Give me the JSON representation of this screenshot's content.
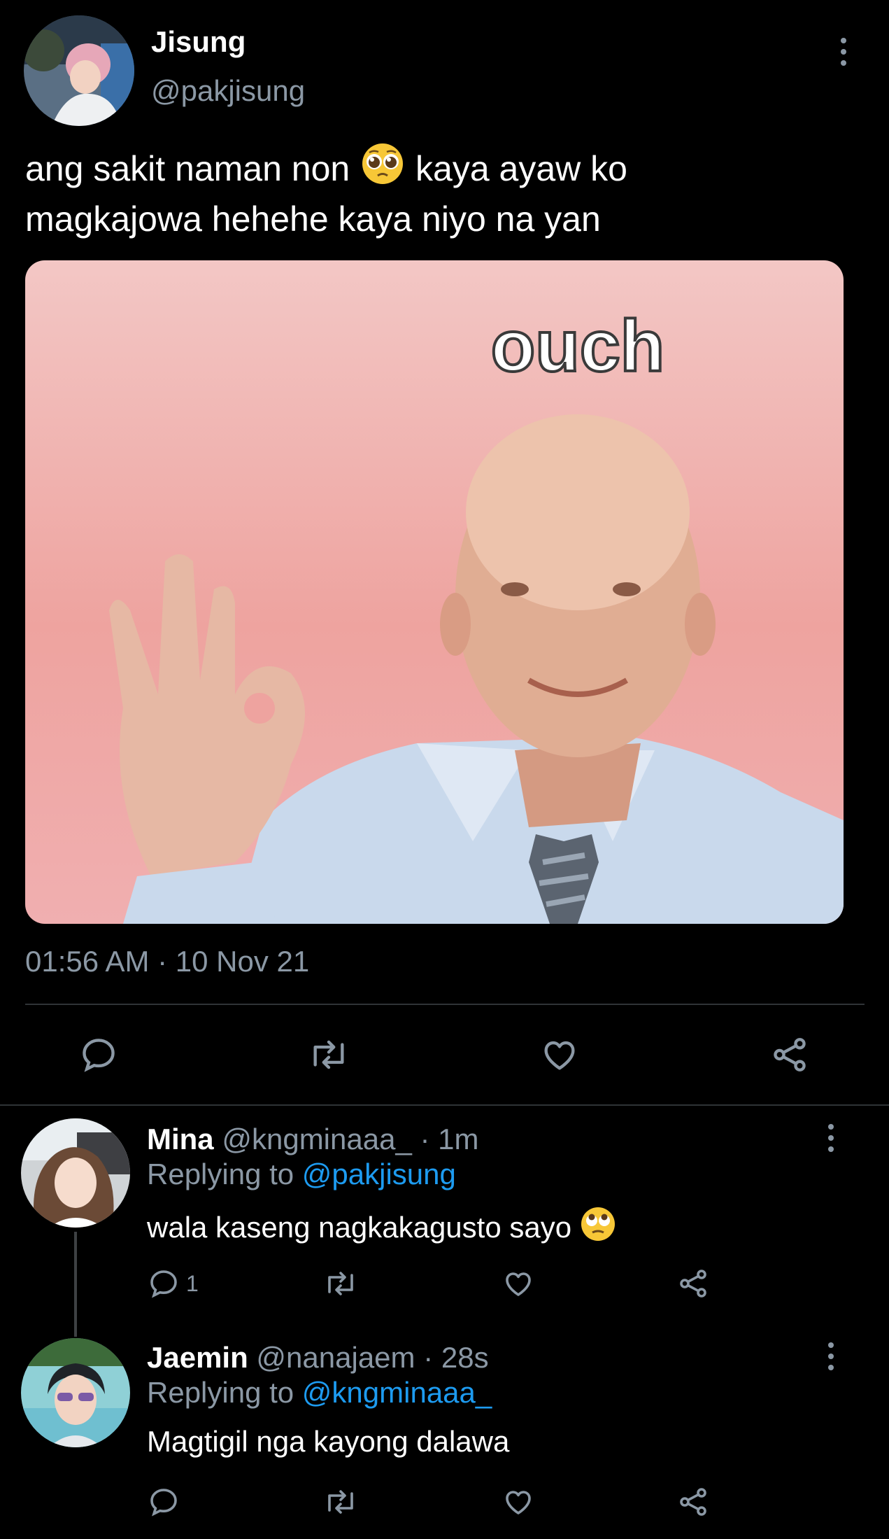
{
  "main_tweet": {
    "author_name": "Jisung",
    "author_handle": "@pakjisung",
    "text_part1": "ang sakit naman non",
    "emoji1": "pleading-face",
    "text_part2": "kaya ayaw ko",
    "text_line2": "magkajowa hehehe kaya niyo na yan",
    "image_caption": "ouch",
    "timestamp": "01:56 AM · 10 Nov 21"
  },
  "actions": [
    "reply-icon",
    "retweet-icon",
    "like-icon",
    "share-icon"
  ],
  "replies": [
    {
      "author_name": "Mina",
      "author_handle": "@kngminaaa_",
      "time": "· 1m",
      "replying_prefix": "Replying to",
      "replying_to": "@pakjisung",
      "text": "wala kaseng nagkakagusto sayo",
      "emoji": "eye-roll-face",
      "reply_count": "1"
    },
    {
      "author_name": "Jaemin",
      "author_handle": "@nanajaem",
      "time": "· 28s",
      "replying_prefix": "Replying to",
      "replying_to": "@kngminaaa_",
      "text": "Magtigil nga kayong dalawa",
      "reply_count": ""
    }
  ],
  "colors": {
    "background": "#000000",
    "accent_link": "#1d9bf0",
    "secondary_text": "#8b98a5",
    "divider": "#2f3336"
  }
}
